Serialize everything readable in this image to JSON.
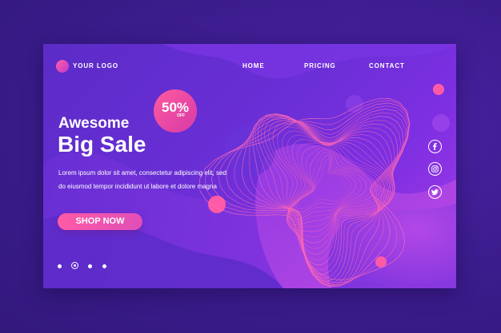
{
  "brand": {
    "logo_text": "YOUR LOGO"
  },
  "nav": {
    "items": [
      {
        "label": "HOME"
      },
      {
        "label": "PRICING"
      },
      {
        "label": "CONTACT"
      }
    ]
  },
  "badge": {
    "percent": "50%",
    "off": "OFF"
  },
  "hero": {
    "title_line1": "Awesome",
    "title_line2": "Big Sale",
    "description_line1": "Lorem ipsum dolor sit amet, consectetur adipiscing elit, sed",
    "description_line2": "do eiusmod tempor incididunt ut labore et dolore magna",
    "cta_label": "SHOP NOW"
  },
  "carousel": {
    "dot_count": 4,
    "active_index": 1
  },
  "social": {
    "icons": [
      "facebook-icon",
      "instagram-icon",
      "twitter-icon"
    ]
  },
  "colors": {
    "accent": "#ff5aa6",
    "background": "#5b2bc7",
    "outer": "#3a1d8a"
  }
}
